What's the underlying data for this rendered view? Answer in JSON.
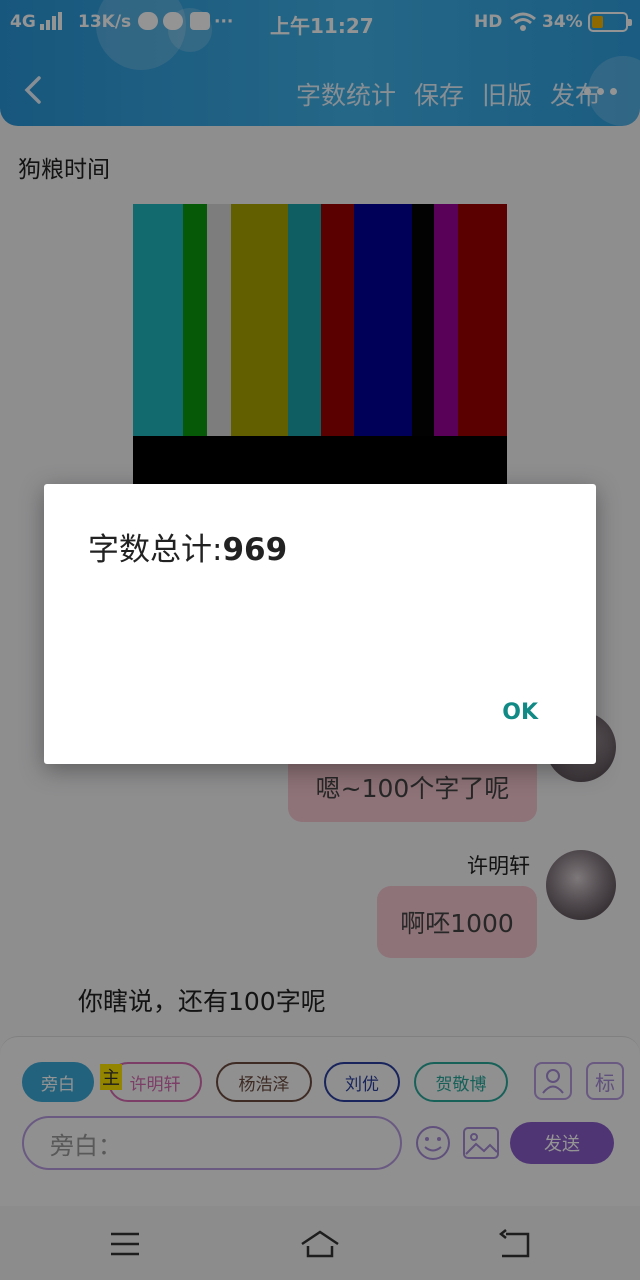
{
  "status_bar": {
    "network": "4G",
    "speed": "13K/s",
    "time": "上午11:27",
    "hd": "HD",
    "battery_percent": "34%",
    "battery_level": 0.34
  },
  "header": {
    "actions": [
      "字数统计",
      "保存",
      "旧版",
      "发布"
    ]
  },
  "story": {
    "title": "狗粮时间"
  },
  "messages": [
    {
      "text": "嗯~100个字了呢"
    },
    {
      "name": "许明轩",
      "text": "啊呸1000"
    }
  ],
  "narration": "你瞎说，还有100字呢",
  "composer": {
    "chips": [
      {
        "label": "旁白",
        "color": "#3ba9d8",
        "active": true
      },
      {
        "label": "许明轩",
        "color": "#d66bb0"
      },
      {
        "label": "杨浩泽",
        "color": "#6b4a3f"
      },
      {
        "label": "刘优",
        "color": "#2a3f9e"
      },
      {
        "label": "贺敬博",
        "color": "#2aa89a"
      }
    ],
    "host_tag": "主",
    "flag_button": "标",
    "input_placeholder": "旁白：",
    "send_label": "发送"
  },
  "dialog": {
    "message_prefix": "字数总计:",
    "word_count": "969",
    "ok_label": "OK"
  },
  "colors": {
    "header": "#3fb2e8",
    "accent_purple": "#8b5cc9",
    "ok_teal": "#118a86"
  },
  "test_pattern_colors": [
    "#1fb7c0",
    "#0c9a0c",
    "#d8d8d8",
    "#a9a400",
    "#1aa3a8",
    "#9c0000",
    "#00009a",
    "#050505",
    "#9a009a",
    "#9c0000"
  ]
}
